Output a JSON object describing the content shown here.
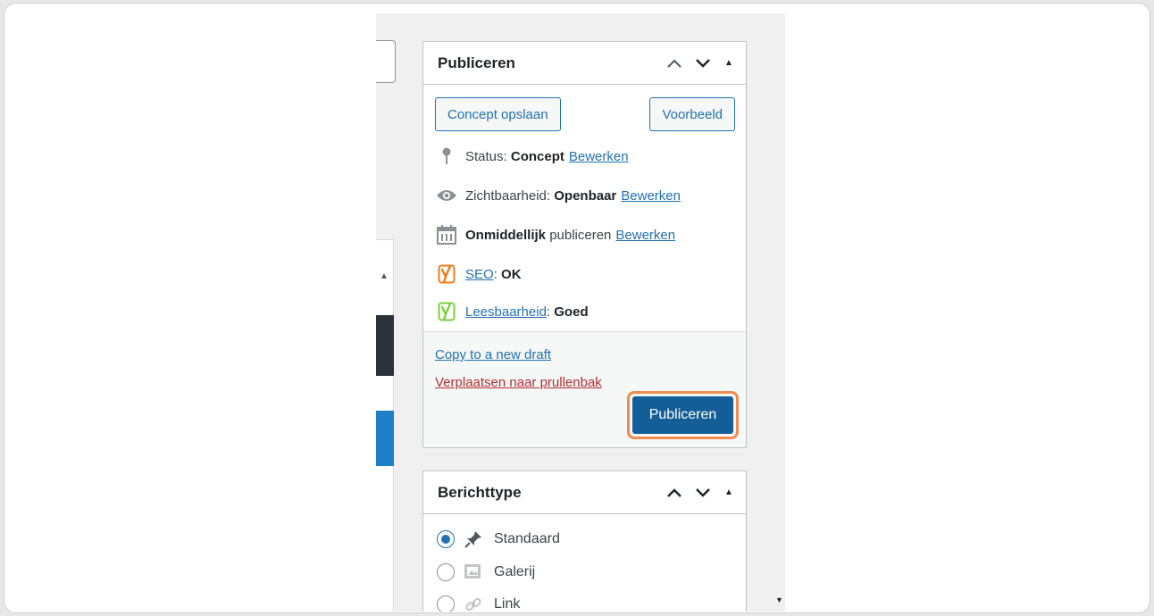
{
  "publish_box": {
    "title": "Publiceren",
    "save_draft_label": "Concept opslaan",
    "preview_label": "Voorbeeld",
    "status": {
      "label": "Status:",
      "value": "Concept",
      "edit": "Bewerken"
    },
    "visibility": {
      "label": "Zichtbaarheid:",
      "value": "Openbaar",
      "edit": "Bewerken"
    },
    "schedule": {
      "value": "Onmiddellijk",
      "label": "publiceren",
      "edit": "Bewerken"
    },
    "seo": {
      "link": "SEO",
      "sep": ":",
      "value": "OK",
      "color": "#ee7c1b"
    },
    "readability": {
      "link": "Leesbaarheid",
      "sep": ":",
      "value": "Goed",
      "color": "#7ad03a"
    },
    "copy_draft_label": "Copy to a new draft",
    "trash_label": "Verplaatsen naar prullenbak",
    "publish_label": "Publiceren"
  },
  "format_box": {
    "title": "Berichttype",
    "options": [
      {
        "label": "Standaard",
        "icon": "pin-icon",
        "selected": true
      },
      {
        "label": "Galerij",
        "icon": "gallery-icon",
        "selected": false
      },
      {
        "label": "Link",
        "icon": "link-icon",
        "selected": false
      }
    ]
  },
  "colors": {
    "primary": "#2271b1",
    "primary_dark": "#135e96",
    "danger": "#b32d2e",
    "highlight": "#f28c4e"
  }
}
